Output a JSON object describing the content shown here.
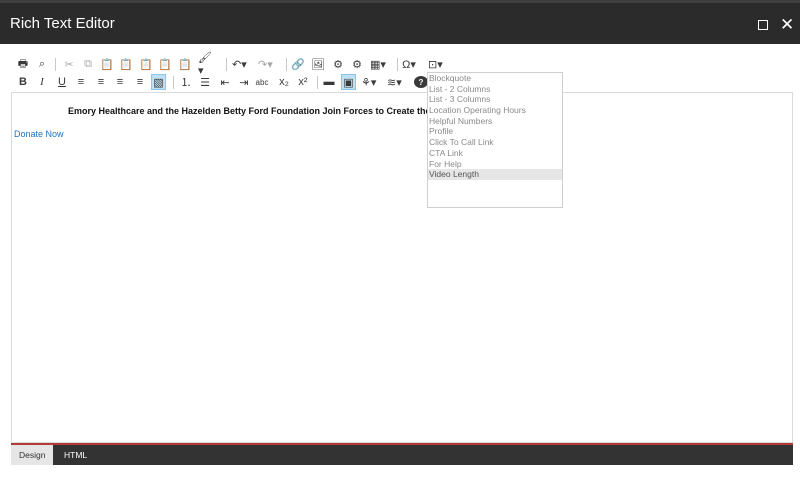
{
  "window": {
    "title": "Rich Text Editor",
    "maximize_icon": "maximize-icon",
    "close_glyph": "✕"
  },
  "toolbar": {
    "row1": [
      {
        "name": "print-icon",
        "glyph": "🖶"
      },
      {
        "name": "find-icon",
        "glyph": "⌕"
      },
      {
        "name": "cut-icon",
        "glyph": "✂"
      },
      {
        "name": "copy-icon",
        "glyph": "⧉"
      },
      {
        "name": "paste-icon",
        "glyph": "📋"
      },
      {
        "name": "paste-word-icon",
        "glyph": "📋"
      },
      {
        "name": "paste-text-icon",
        "glyph": "📋"
      },
      {
        "name": "paste-html-icon",
        "glyph": "📋"
      },
      {
        "name": "paste-options-icon",
        "glyph": "📋"
      },
      {
        "name": "format-painter-icon",
        "glyph": "🖌▾"
      },
      {
        "name": "undo-icon",
        "glyph": "↶▾"
      },
      {
        "name": "redo-icon",
        "glyph": "↷▾"
      },
      {
        "name": "link-manager-icon",
        "glyph": "🔗"
      },
      {
        "name": "image-manager-icon",
        "glyph": "🖼"
      },
      {
        "name": "media-manager-icon",
        "glyph": "⚙"
      },
      {
        "name": "document-manager-icon",
        "glyph": "⚙"
      },
      {
        "name": "table-icon",
        "glyph": "▦▾"
      },
      {
        "name": "special-characters-icon",
        "glyph": "Ω▾"
      },
      {
        "name": "insert-snippet-icon",
        "glyph": "⊡▾"
      }
    ],
    "row2": [
      {
        "name": "bold-icon",
        "glyph": "B"
      },
      {
        "name": "italic-icon",
        "glyph": "I"
      },
      {
        "name": "underline-icon",
        "glyph": "U"
      },
      {
        "name": "align-left-icon",
        "glyph": "≡"
      },
      {
        "name": "align-center-icon",
        "glyph": "≡"
      },
      {
        "name": "align-right-icon",
        "glyph": "≡"
      },
      {
        "name": "justify-icon",
        "glyph": "≡"
      },
      {
        "name": "strike-box-icon",
        "glyph": "▧"
      },
      {
        "name": "ordered-list-icon",
        "glyph": "⒈"
      },
      {
        "name": "bullet-list-icon",
        "glyph": "☰"
      },
      {
        "name": "outdent-icon",
        "glyph": "⇤"
      },
      {
        "name": "indent-icon",
        "glyph": "⇥"
      },
      {
        "name": "spellcheck-icon",
        "glyph": "abc"
      },
      {
        "name": "subscript-icon",
        "glyph": "x₂"
      },
      {
        "name": "superscript-icon",
        "glyph": "x²"
      },
      {
        "name": "paragraph-icon",
        "glyph": "▬"
      },
      {
        "name": "snippet-icon",
        "glyph": "▣"
      },
      {
        "name": "module-icon",
        "glyph": "⚘▾"
      },
      {
        "name": "styles-icon",
        "glyph": "≋▾"
      },
      {
        "name": "help-icon",
        "glyph": "?"
      }
    ]
  },
  "content": {
    "headline": "Emory Healthcare and the Hazelden Betty Ford Foundation Join Forces to Create the A",
    "donate_link": "Donate Now"
  },
  "dropdown": {
    "items": [
      "Blockquote",
      "List - 2 Columns",
      "List - 3 Columns",
      "Location Operating Hours",
      "Helpful Numbers",
      "Profile",
      "Click To Call Link",
      "CTA Link",
      "For Help",
      "Video Length"
    ],
    "hovered_index": 9
  },
  "tabs": {
    "design": "Design",
    "html": "HTML"
  },
  "colors": {
    "titlebar": "#2b2b2b",
    "link": "#1a73c4",
    "bottom_bar": "#333333",
    "bottom_accent": "#b03b3b",
    "active_button": "#bfe0f5"
  }
}
